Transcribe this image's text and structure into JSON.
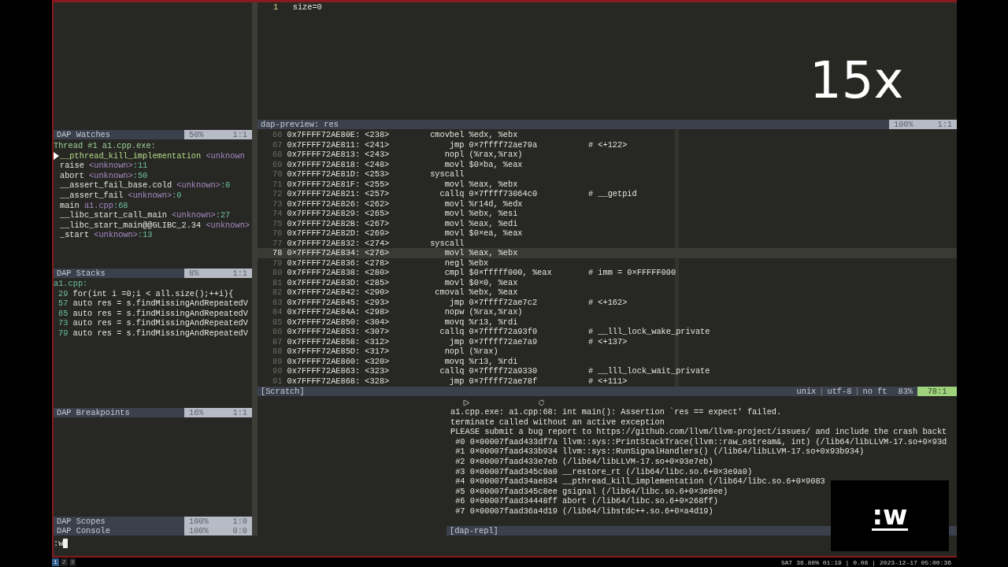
{
  "watches": {
    "title": "DAP Watches",
    "percent": "50%",
    "position": "1:1",
    "thread": "Thread #1 a1.cpp.exe:",
    "frames": [
      {
        "name": "__pthread_kill_implementation",
        "location": "<unknown",
        "selected": true
      },
      {
        "name": "raise",
        "location": "<unknown>",
        "line": ":11",
        "selected": false
      },
      {
        "name": "abort",
        "location": "<unknown>",
        "line": ":50",
        "selected": false
      },
      {
        "name": "__assert_fail_base.cold",
        "location": "<unknown>",
        "line": ":0",
        "selected": false
      },
      {
        "name": "__assert_fail",
        "location": "<unknown>",
        "line": ":0",
        "selected": false
      },
      {
        "name": "main",
        "location": "a1.cpp",
        "line": ":68",
        "selected": false
      },
      {
        "name": "__libc_start_call_main",
        "location": "<unknown>",
        "line": ":27",
        "selected": false
      },
      {
        "name": "__libc_start_main@@GLIBC_2.34",
        "location": "<unknown>",
        "selected": false
      },
      {
        "name": "_start",
        "location": "<unknown>",
        "line": ":13",
        "selected": false
      }
    ]
  },
  "stacks": {
    "title": "DAP Stacks",
    "percent": "8%",
    "position": "1:1",
    "file": "a1.cpp:",
    "lines": [
      {
        "number": "29",
        "code": "for(int i =0;i < all.size();++i){"
      },
      {
        "number": "57",
        "code": "auto res = s.findMissingAndRepeatedV"
      },
      {
        "number": "65",
        "code": "auto res = s.findMissingAndRepeatedV"
      },
      {
        "number": "73",
        "code": "auto res = s.findMissingAndRepeatedV"
      },
      {
        "number": "79",
        "code": "auto res = s.findMissingAndRepeatedV"
      }
    ]
  },
  "breakpoints": {
    "title": "DAP Breakpoints",
    "percent": "16%",
    "position": "1:1"
  },
  "scopes": {
    "title": "DAP Scopes",
    "percent": "100%",
    "position": "1:0"
  },
  "command_line": ":w",
  "editor": {
    "lines": [
      {
        "number": "1",
        "text": "size=0"
      }
    ]
  },
  "preview_status": {
    "title": "dap-preview: res",
    "percent": "100%",
    "position": "1:1"
  },
  "disassembly": {
    "rows": [
      {
        "number": "66",
        "address": "0x7FFFF72AE80E:",
        "offset": "<238>",
        "mnemonic": "cmovbel",
        "operands": "%edx, %ebx",
        "selected": false
      },
      {
        "number": "67",
        "address": "0x7FFFF72AE811:",
        "offset": "<241>",
        "mnemonic": "jmp",
        "operands": "0×7ffff72ae79a",
        "comment": "# <+122>",
        "selected": false
      },
      {
        "number": "68",
        "address": "0x7FFFF72AE813:",
        "offset": "<243>",
        "mnemonic": "nopl",
        "operands": "(%rax,%rax)",
        "selected": false
      },
      {
        "number": "69",
        "address": "0x7FFFF72AE818:",
        "offset": "<248>",
        "mnemonic": "movl",
        "operands": "$0×ba, %eax",
        "selected": false
      },
      {
        "number": "70",
        "address": "0x7FFFF72AE81D:",
        "offset": "<253>",
        "mnemonic": "syscall",
        "selected": false
      },
      {
        "number": "71",
        "address": "0x7FFFF72AE81F:",
        "offset": "<255>",
        "mnemonic": "movl",
        "operands": "%eax, %ebx",
        "selected": false
      },
      {
        "number": "72",
        "address": "0x7FFFF72AE821:",
        "offset": "<257>",
        "mnemonic": "callq",
        "operands": "0×7ffff73064c0",
        "comment": "# __getpid",
        "selected": false
      },
      {
        "number": "73",
        "address": "0x7FFFF72AE826:",
        "offset": "<262>",
        "mnemonic": "movl",
        "operands": "%r14d, %edx",
        "selected": false
      },
      {
        "number": "74",
        "address": "0x7FFFF72AE829:",
        "offset": "<265>",
        "mnemonic": "movl",
        "operands": "%ebx, %esi",
        "selected": false
      },
      {
        "number": "75",
        "address": "0x7FFFF72AE82B:",
        "offset": "<267>",
        "mnemonic": "movl",
        "operands": "%eax, %edi",
        "selected": false
      },
      {
        "number": "76",
        "address": "0x7FFFF72AE82D:",
        "offset": "<269>",
        "mnemonic": "movl",
        "operands": "$0×ea, %eax",
        "selected": false
      },
      {
        "number": "77",
        "address": "0x7FFFF72AE832:",
        "offset": "<274>",
        "mnemonic": "syscall",
        "selected": false
      },
      {
        "number": "78",
        "address": "0×7FFFF72AE834:",
        "offset": "<276>",
        "mnemonic": "movl",
        "operands": "%eax, %ebx",
        "selected": true
      },
      {
        "number": "79",
        "address": "0x7FFFF72AE836:",
        "offset": "<278>",
        "mnemonic": "negl",
        "operands": "%ebx",
        "selected": false
      },
      {
        "number": "80",
        "address": "0x7FFFF72AE838:",
        "offset": "<280>",
        "mnemonic": "cmpl",
        "operands": "$0×fffff000, %eax",
        "comment": "# imm = 0×FFFFF000",
        "selected": false
      },
      {
        "number": "81",
        "address": "0x7FFFF72AE83D:",
        "offset": "<285>",
        "mnemonic": "movl",
        "operands": "$0×0, %eax",
        "selected": false
      },
      {
        "number": "82",
        "address": "0x7FFFF72AE842:",
        "offset": "<290>",
        "mnemonic": "cmoval",
        "operands": "%ebx, %eax",
        "selected": false
      },
      {
        "number": "83",
        "address": "0x7FFFF72AE845:",
        "offset": "<293>",
        "mnemonic": "jmp",
        "operands": "0×7ffff72ae7c2",
        "comment": "# <+162>",
        "selected": false
      },
      {
        "number": "84",
        "address": "0x7FFFF72AE84A:",
        "offset": "<298>",
        "mnemonic": "nopw",
        "operands": "(%rax,%rax)",
        "selected": false
      },
      {
        "number": "85",
        "address": "0x7FFFF72AE850:",
        "offset": "<304>",
        "mnemonic": "movq",
        "operands": "%r13, %rdi",
        "selected": false
      },
      {
        "number": "86",
        "address": "0x7FFFF72AE853:",
        "offset": "<307>",
        "mnemonic": "callq",
        "operands": "0×7ffff72a93f0",
        "comment": "# __lll_lock_wake_private",
        "selected": false
      },
      {
        "number": "87",
        "address": "0x7FFFF72AE858:",
        "offset": "<312>",
        "mnemonic": "jmp",
        "operands": "0×7ffff72ae7a9",
        "comment": "# <+137>",
        "selected": false
      },
      {
        "number": "88",
        "address": "0x7FFFF72AE85D:",
        "offset": "<317>",
        "mnemonic": "nopl",
        "operands": "(%rax)",
        "selected": false
      },
      {
        "number": "89",
        "address": "0x7FFFF72AE860:",
        "offset": "<320>",
        "mnemonic": "movq",
        "operands": "%r13, %rdi",
        "selected": false
      },
      {
        "number": "90",
        "address": "0x7FFFF72AE863:",
        "offset": "<323>",
        "mnemonic": "callq",
        "operands": "0×7ffff72a9330",
        "comment": "# __lll_lock_wait_private",
        "selected": false
      },
      {
        "number": "91",
        "address": "0x7FFFF72AE868:",
        "offset": "<328>",
        "mnemonic": "jmp",
        "operands": "0×7ffff72ae78f",
        "comment": "# <+111>",
        "selected": false
      }
    ]
  },
  "scratch_status": {
    "title": "[Scratch]",
    "format": "unix",
    "separators": [
      "|",
      "|"
    ],
    "encoding": "utf-8",
    "filetype": "no ft",
    "percent": "83%",
    "position": "78:1"
  },
  "console_status": {
    "title": "DAP Console",
    "percent": "100%",
    "position": "0:0"
  },
  "repl": {
    "status": "[dap-repl]",
    "lines": [
      "a1.cpp.exe: a1.cpp:68: int main(): Assertion `res == expect' failed.",
      "terminate called without an active exception",
      "PLEASE submit a bug report to https://github.com/llvm/llvm-project/issues/ and include the crash backt",
      " #0 0×00007faad433df7a llvm::sys::PrintStackTrace(llvm::raw_ostream&, int) (/lib64/libLLVM-17.so+0×93d",
      " #1 0×00007faad433b934 llvm::sys::RunSignalHandlers() (/lib64/libLLVM-17.so+0x93b934)",
      " #2 0×00007faad433e7eb (/lib64/libLLVM-17.so+0×93e7eb)",
      " #3 0×00007faad345c9a0 __restore_rt (/lib64/libc.so.6+0×3e9a0)",
      " #4 0×00007faad34ae834 __pthread_kill_implementation (/lib64/libc.so.6+0×9083",
      " #5 0×00007faad345c8ee gsignal (/lib64/libc.so.6+0×3e8ee)",
      " #6 0×00007faad34448ff abort (/lib64/libc.so.6+0×268ff)",
      " #7 0×00007faad36a4d19 (/lib64/libstdc++.so.6+0×a4d19)"
    ]
  },
  "overlay": {
    "zoom": "15x",
    "keys": ":w"
  },
  "tabs": [
    {
      "label": "1",
      "selected": true
    },
    {
      "label": "2",
      "selected": false
    },
    {
      "label": "3",
      "selected": false
    }
  ],
  "system_status": "SAT 36.80% 01:19 | 0.08 | 2023-12-17 05:00:36"
}
